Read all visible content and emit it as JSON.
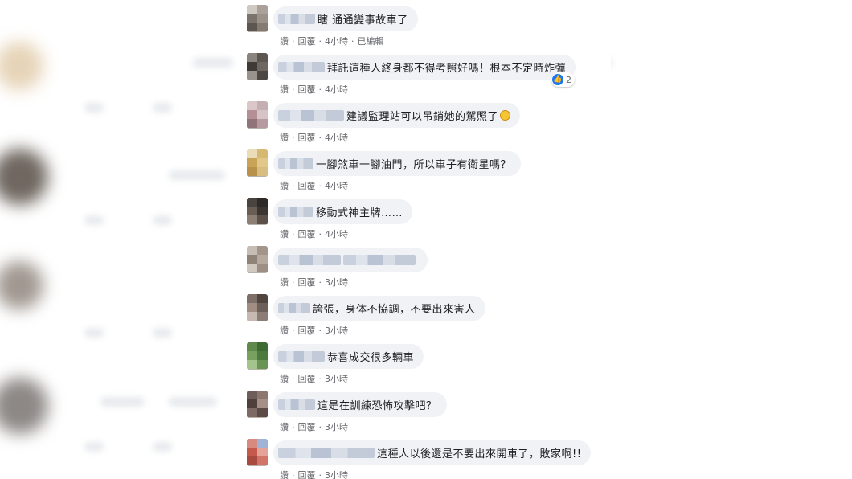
{
  "colors": {
    "bubble": "#f0f2f5",
    "text": "#1c1e21",
    "meta": "#65676b",
    "like": "#1877f2"
  },
  "comments": [
    {
      "text": "瞎 通通變事故車了",
      "like": "讚",
      "reply": "回覆",
      "time": "4小時",
      "edited": "已編輯"
    },
    {
      "text": "拜託這種人終身都不得考照好嗎！根本不定時炸彈",
      "like": "讚",
      "reply": "回覆",
      "time": "4小時",
      "reaction_count": "2",
      "reaction_icon": "like-icon"
    },
    {
      "text": "建議監理站可以吊銷她的駕照了",
      "emoji": "laughing-crying-emoji-icon",
      "like": "讚",
      "reply": "回覆",
      "time": "4小時"
    },
    {
      "text": "一腳煞車一腳油門，所以車子有衛星嗎？",
      "like": "讚",
      "reply": "回覆",
      "time": "4小時"
    },
    {
      "text": "移動式神主牌……",
      "like": "讚",
      "reply": "回覆",
      "time": "4小時"
    },
    {
      "text": "",
      "like": "讚",
      "reply": "回覆",
      "time": "3小時"
    },
    {
      "text": "誇張，身体不協調，不要出來害人",
      "like": "讚",
      "reply": "回覆",
      "time": "3小時"
    },
    {
      "text": "恭喜成交很多輛車",
      "like": "讚",
      "reply": "回覆",
      "time": "3小時"
    },
    {
      "text": "這是在訓練恐怖攻擊吧？",
      "like": "讚",
      "reply": "回覆",
      "time": "3小時"
    },
    {
      "text": "這種人以後還是不要出來開車了，敗家啊!!",
      "like": "讚",
      "reply": "回覆",
      "time": "3小時"
    }
  ]
}
